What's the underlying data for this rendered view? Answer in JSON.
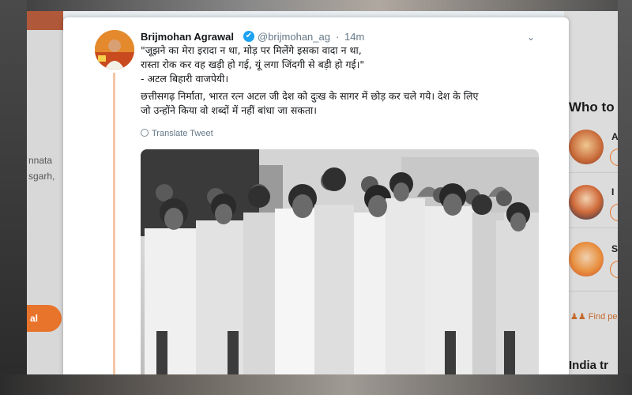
{
  "background": {
    "left_text_lines": [
      "nnata",
      "sgarh,"
    ],
    "left_button_label": "al",
    "right_title": "Who to",
    "right_letters": [
      "A",
      "I",
      "S"
    ],
    "find_people": "Find pe",
    "trends_title": "India tr"
  },
  "tweet": {
    "author_name": "Brijmohan Agrawal",
    "verified_icon": "✔",
    "handle": "@brijmohan_ag",
    "separator": "·",
    "time": "14m",
    "caret_icon": "⌄",
    "lines": [
      "\"जूझने का मेरा इरादा न था, मोड़ पर मिलेंगे इसका वादा न था,",
      "रास्ता रोक कर वह खड़ी हो गई, यूं लगा जिंदगी से बड़ी हो गई।\"",
      "- अटल बिहारी वाजपेयी।",
      "छत्तीसगढ़ निर्माता, भारत रत्न अटल जी देश को दुःख के सागर में छोड़ कर चले गये। देश के लिए",
      "जो उन्होंने किया वो शब्दों में नहीं बांधा जा सकता।"
    ],
    "translate_label": "Translate Tweet"
  },
  "colors": {
    "accent": "#e8742c",
    "verified": "#1da1f2",
    "muted": "#657786",
    "text": "#14171a"
  }
}
